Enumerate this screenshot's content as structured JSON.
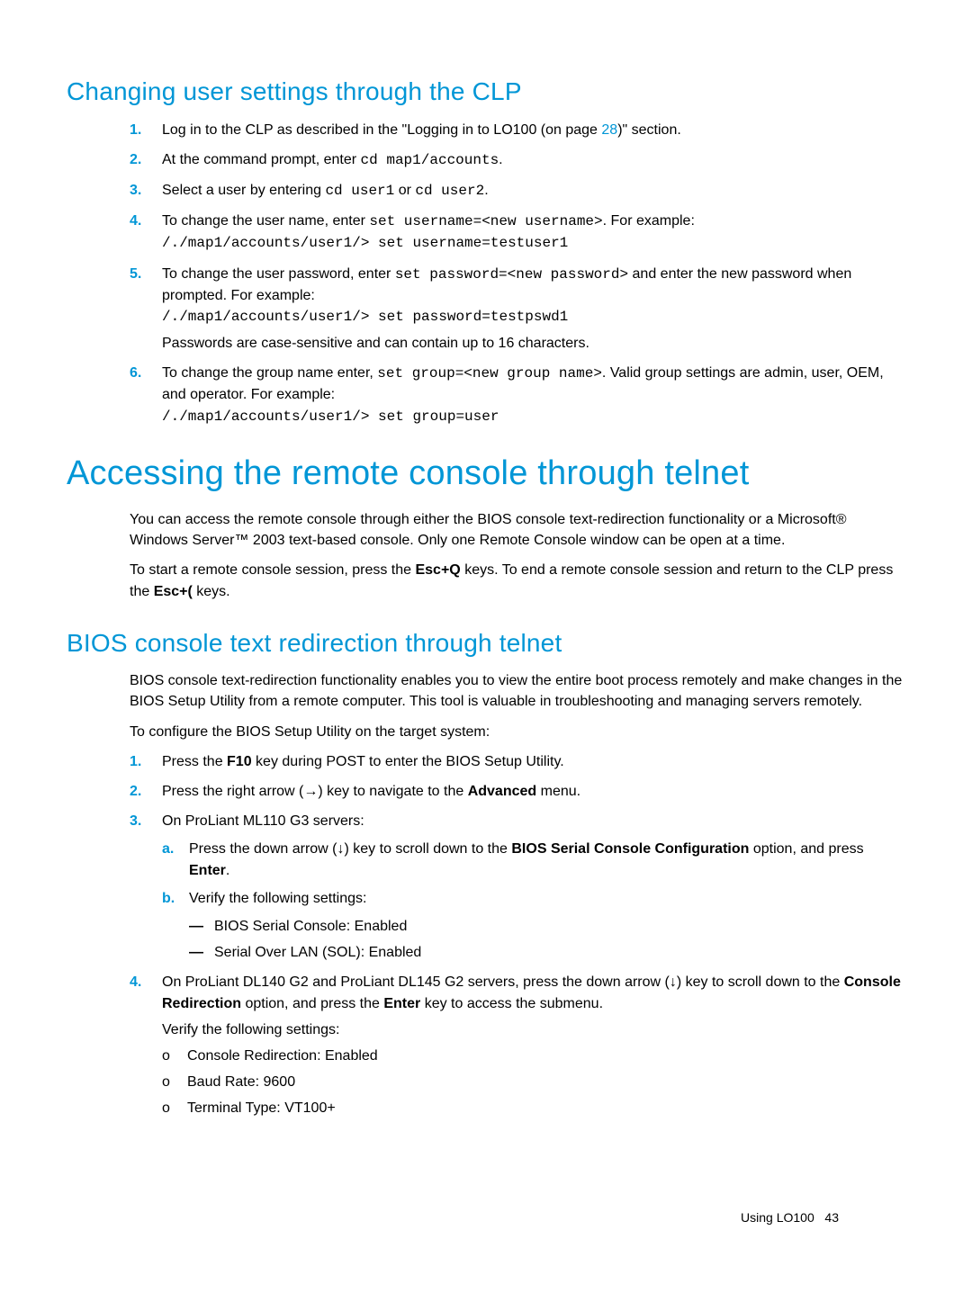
{
  "section1": {
    "heading": "Changing user settings through the CLP",
    "steps": [
      {
        "n": "1.",
        "pre": "Log in to the CLP as described in the \"Logging in to LO100 (on page ",
        "link": "28",
        "post": ")\" section."
      },
      {
        "n": "2.",
        "pre": "At the command prompt, enter ",
        "code": "cd map1/accounts",
        "post": "."
      },
      {
        "n": "3.",
        "pre": "Select a user by entering ",
        "code": "cd user1",
        "mid": " or ",
        "code2": "cd user2",
        "post": "."
      },
      {
        "n": "4.",
        "pre": "To change the user name, enter ",
        "code": "set username=<new username>",
        "post": ". For example:",
        "example": "/./map1/accounts/user1/> set username=testuser1"
      },
      {
        "n": "5.",
        "pre": "To change the user password, enter ",
        "code": "set password=<new password>",
        "post": " and enter the new password when prompted. For example:",
        "example": "/./map1/accounts/user1/> set password=testpswd1",
        "note": "Passwords are case-sensitive and can contain up to 16 characters."
      },
      {
        "n": "6.",
        "pre": "To change the group name enter, ",
        "code": "set group=<new group name>",
        "post": ". Valid group settings are admin, user, OEM, and operator. For example:",
        "example": "/./map1/accounts/user1/> set group=user"
      }
    ]
  },
  "section2": {
    "heading": "Accessing the remote console through telnet",
    "p1": "You can access the remote console through either the BIOS console text-redirection functionality or a Microsoft® Windows Server™ 2003 text-based console. Only one Remote Console window can be open at a time.",
    "p2a": "To start a remote console session, press the ",
    "p2b": "Esc+Q",
    "p2c": " keys. To end a remote console session and return to the CLP press the ",
    "p2d": "Esc+(",
    "p2e": " keys."
  },
  "section3": {
    "heading": "BIOS console text redirection through telnet",
    "p1": "BIOS console text-redirection functionality enables you to view the entire boot process remotely and make changes in the BIOS Setup Utility from a remote computer. This tool is valuable in troubleshooting and managing servers remotely.",
    "p2": "To configure the BIOS Setup Utility on the target system:",
    "steps": [
      {
        "n": "1.",
        "pre": "Press the ",
        "bold": "F10",
        "post": " key during POST to enter the BIOS Setup Utility."
      },
      {
        "n": "2.",
        "pre": "Press the right arrow (→) key to navigate to the ",
        "bold": "Advanced",
        "post": " menu."
      },
      {
        "n": "3.",
        "text": "On ProLiant ML110 G3 servers:",
        "sub": [
          {
            "m": "a.",
            "pre": "Press the down arrow (↓) key to scroll down to the ",
            "bold": "BIOS Serial Console Configuration",
            "post": " option, and press ",
            "bold2": "Enter",
            "post2": "."
          },
          {
            "m": "b.",
            "text": "Verify the following settings:",
            "dash": [
              "BIOS Serial Console: Enabled",
              "Serial Over LAN (SOL): Enabled"
            ]
          }
        ]
      },
      {
        "n": "4.",
        "pre": "On ProLiant DL140 G2 and ProLiant DL145 G2 servers, press the down arrow (↓) key to scroll down to the ",
        "bold": "Console Redirection",
        "mid": " option, and press the ",
        "bold2": "Enter",
        "post": " key to access the submenu.",
        "verify": "Verify the following settings:",
        "o": [
          "Console Redirection: Enabled",
          "Baud Rate: 9600",
          "Terminal Type: VT100+"
        ]
      }
    ]
  },
  "footer": {
    "text": "Using LO100",
    "page": "43"
  }
}
